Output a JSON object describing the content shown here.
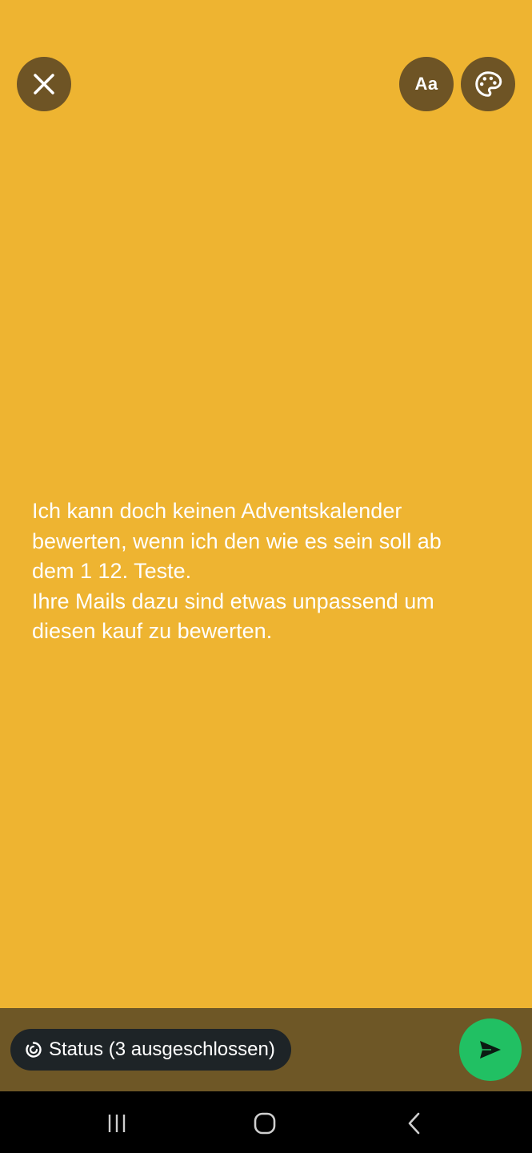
{
  "colors": {
    "background": "#EEB431",
    "button_bg": "#6E5425",
    "bottom_bar": "#6E5726",
    "chip_bg": "#1E2427",
    "send_accent": "#21C063",
    "text": "#FFFFFF"
  },
  "toolbar": {
    "close_icon": "close-icon",
    "font_label": "Aa",
    "palette_icon": "palette-icon"
  },
  "status": {
    "text": "Ich kann doch keinen Adventskalender\nbewerten, wenn ich den wie es sein soll ab\ndem 1 12. Teste.\nIhre Mails dazu sind etwas unpassend um\ndiesen kauf zu bewerten."
  },
  "composer": {
    "audience_icon": "status-ring-icon",
    "audience_label": "Status (3 ausgeschlossen)",
    "send_icon": "send-icon"
  },
  "navigation": {
    "recents_icon": "recents-icon",
    "home_icon": "home-icon",
    "back_icon": "back-icon"
  }
}
